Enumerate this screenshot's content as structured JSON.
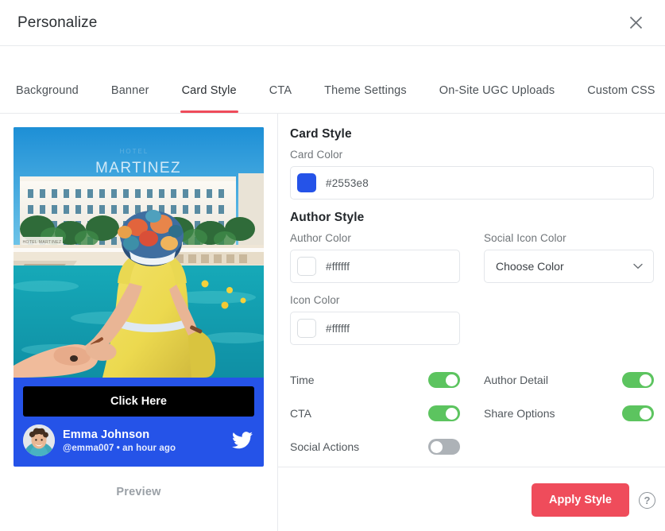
{
  "header": {
    "title": "Personalize",
    "close_icon": "close-icon"
  },
  "tabs": [
    {
      "label": "Background",
      "active": false
    },
    {
      "label": "Banner",
      "active": false
    },
    {
      "label": "Card Style",
      "active": true
    },
    {
      "label": "CTA",
      "active": false
    },
    {
      "label": "Theme Settings",
      "active": false
    },
    {
      "label": "On-Site UGC Uploads",
      "active": false
    },
    {
      "label": "Custom CSS",
      "active": false
    }
  ],
  "preview": {
    "label": "Preview",
    "card_background": "#2553e8",
    "photo_alt": "MARTINEZ",
    "photo_sign_text": "MARTINEZ",
    "hotel_sign_text": "HOTEL MARTINEZ",
    "cta_label": "Click Here",
    "cta_background": "#000000",
    "author_name": "Emma Johnson",
    "author_meta": "@emma007  •  an hour ago",
    "social_icon": "twitter-icon"
  },
  "form": {
    "card_style_title": "Card Style",
    "card_color_label": "Card Color",
    "card_color_value": "#2553e8",
    "author_style_title": "Author Style",
    "author_color_label": "Author Color",
    "author_color_value": "#ffffff",
    "social_icon_color_label": "Social Icon Color",
    "social_icon_color_value": "Choose Color",
    "icon_color_label": "Icon Color",
    "icon_color_value": "#ffffff"
  },
  "toggles": [
    {
      "label": "Time",
      "state": "on"
    },
    {
      "label": "Author Detail",
      "state": "on"
    },
    {
      "label": "CTA",
      "state": "on"
    },
    {
      "label": "Share Options",
      "state": "on"
    },
    {
      "label": "Social Actions",
      "state": "off"
    }
  ],
  "footer": {
    "apply_label": "Apply Style",
    "help_icon": "?",
    "accent_color": "#ef4c5b"
  }
}
